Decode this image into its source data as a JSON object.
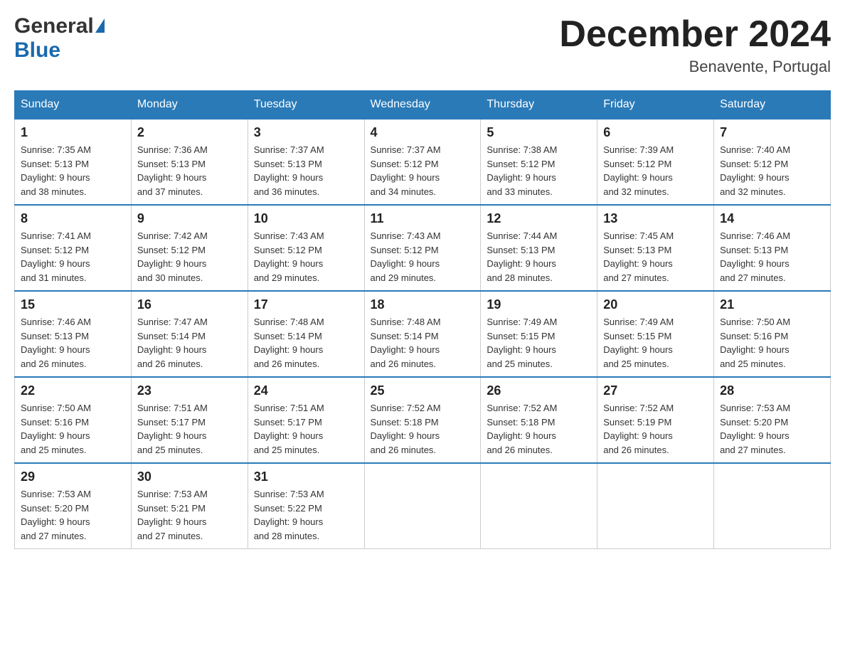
{
  "header": {
    "logo_general": "General",
    "logo_blue": "Blue",
    "month_title": "December 2024",
    "location": "Benavente, Portugal"
  },
  "weekdays": [
    "Sunday",
    "Monday",
    "Tuesday",
    "Wednesday",
    "Thursday",
    "Friday",
    "Saturday"
  ],
  "weeks": [
    [
      {
        "day": "1",
        "sunrise": "7:35 AM",
        "sunset": "5:13 PM",
        "daylight": "9 hours and 38 minutes."
      },
      {
        "day": "2",
        "sunrise": "7:36 AM",
        "sunset": "5:13 PM",
        "daylight": "9 hours and 37 minutes."
      },
      {
        "day": "3",
        "sunrise": "7:37 AM",
        "sunset": "5:13 PM",
        "daylight": "9 hours and 36 minutes."
      },
      {
        "day": "4",
        "sunrise": "7:37 AM",
        "sunset": "5:12 PM",
        "daylight": "9 hours and 34 minutes."
      },
      {
        "day": "5",
        "sunrise": "7:38 AM",
        "sunset": "5:12 PM",
        "daylight": "9 hours and 33 minutes."
      },
      {
        "day": "6",
        "sunrise": "7:39 AM",
        "sunset": "5:12 PM",
        "daylight": "9 hours and 32 minutes."
      },
      {
        "day": "7",
        "sunrise": "7:40 AM",
        "sunset": "5:12 PM",
        "daylight": "9 hours and 32 minutes."
      }
    ],
    [
      {
        "day": "8",
        "sunrise": "7:41 AM",
        "sunset": "5:12 PM",
        "daylight": "9 hours and 31 minutes."
      },
      {
        "day": "9",
        "sunrise": "7:42 AM",
        "sunset": "5:12 PM",
        "daylight": "9 hours and 30 minutes."
      },
      {
        "day": "10",
        "sunrise": "7:43 AM",
        "sunset": "5:12 PM",
        "daylight": "9 hours and 29 minutes."
      },
      {
        "day": "11",
        "sunrise": "7:43 AM",
        "sunset": "5:12 PM",
        "daylight": "9 hours and 29 minutes."
      },
      {
        "day": "12",
        "sunrise": "7:44 AM",
        "sunset": "5:13 PM",
        "daylight": "9 hours and 28 minutes."
      },
      {
        "day": "13",
        "sunrise": "7:45 AM",
        "sunset": "5:13 PM",
        "daylight": "9 hours and 27 minutes."
      },
      {
        "day": "14",
        "sunrise": "7:46 AM",
        "sunset": "5:13 PM",
        "daylight": "9 hours and 27 minutes."
      }
    ],
    [
      {
        "day": "15",
        "sunrise": "7:46 AM",
        "sunset": "5:13 PM",
        "daylight": "9 hours and 26 minutes."
      },
      {
        "day": "16",
        "sunrise": "7:47 AM",
        "sunset": "5:14 PM",
        "daylight": "9 hours and 26 minutes."
      },
      {
        "day": "17",
        "sunrise": "7:48 AM",
        "sunset": "5:14 PM",
        "daylight": "9 hours and 26 minutes."
      },
      {
        "day": "18",
        "sunrise": "7:48 AM",
        "sunset": "5:14 PM",
        "daylight": "9 hours and 26 minutes."
      },
      {
        "day": "19",
        "sunrise": "7:49 AM",
        "sunset": "5:15 PM",
        "daylight": "9 hours and 25 minutes."
      },
      {
        "day": "20",
        "sunrise": "7:49 AM",
        "sunset": "5:15 PM",
        "daylight": "9 hours and 25 minutes."
      },
      {
        "day": "21",
        "sunrise": "7:50 AM",
        "sunset": "5:16 PM",
        "daylight": "9 hours and 25 minutes."
      }
    ],
    [
      {
        "day": "22",
        "sunrise": "7:50 AM",
        "sunset": "5:16 PM",
        "daylight": "9 hours and 25 minutes."
      },
      {
        "day": "23",
        "sunrise": "7:51 AM",
        "sunset": "5:17 PM",
        "daylight": "9 hours and 25 minutes."
      },
      {
        "day": "24",
        "sunrise": "7:51 AM",
        "sunset": "5:17 PM",
        "daylight": "9 hours and 25 minutes."
      },
      {
        "day": "25",
        "sunrise": "7:52 AM",
        "sunset": "5:18 PM",
        "daylight": "9 hours and 26 minutes."
      },
      {
        "day": "26",
        "sunrise": "7:52 AM",
        "sunset": "5:18 PM",
        "daylight": "9 hours and 26 minutes."
      },
      {
        "day": "27",
        "sunrise": "7:52 AM",
        "sunset": "5:19 PM",
        "daylight": "9 hours and 26 minutes."
      },
      {
        "day": "28",
        "sunrise": "7:53 AM",
        "sunset": "5:20 PM",
        "daylight": "9 hours and 27 minutes."
      }
    ],
    [
      {
        "day": "29",
        "sunrise": "7:53 AM",
        "sunset": "5:20 PM",
        "daylight": "9 hours and 27 minutes."
      },
      {
        "day": "30",
        "sunrise": "7:53 AM",
        "sunset": "5:21 PM",
        "daylight": "9 hours and 27 minutes."
      },
      {
        "day": "31",
        "sunrise": "7:53 AM",
        "sunset": "5:22 PM",
        "daylight": "9 hours and 28 minutes."
      },
      null,
      null,
      null,
      null
    ]
  ],
  "labels": {
    "sunrise": "Sunrise:",
    "sunset": "Sunset:",
    "daylight": "Daylight:"
  }
}
